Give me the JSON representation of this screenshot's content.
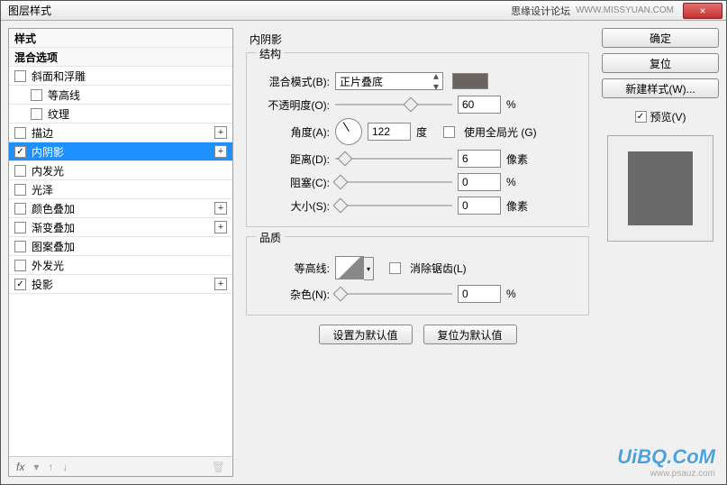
{
  "window": {
    "title": "图层样式",
    "brand": "思缘设计论坛",
    "brand_url": "WWW.MISSYUAN.COM",
    "close": "×"
  },
  "sidebar": {
    "header_styles": "样式",
    "header_blend": "混合选项",
    "items": [
      {
        "label": "斜面和浮雕",
        "checked": false,
        "indent": 0,
        "plus": false
      },
      {
        "label": "等高线",
        "checked": false,
        "indent": 1,
        "plus": false
      },
      {
        "label": "纹理",
        "checked": false,
        "indent": 1,
        "plus": false
      },
      {
        "label": "描边",
        "checked": false,
        "indent": 0,
        "plus": true
      },
      {
        "label": "内阴影",
        "checked": true,
        "indent": 0,
        "plus": true,
        "selected": true
      },
      {
        "label": "内发光",
        "checked": false,
        "indent": 0,
        "plus": false
      },
      {
        "label": "光泽",
        "checked": false,
        "indent": 0,
        "plus": false
      },
      {
        "label": "颜色叠加",
        "checked": false,
        "indent": 0,
        "plus": true
      },
      {
        "label": "渐变叠加",
        "checked": false,
        "indent": 0,
        "plus": true
      },
      {
        "label": "图案叠加",
        "checked": false,
        "indent": 0,
        "plus": false
      },
      {
        "label": "外发光",
        "checked": false,
        "indent": 0,
        "plus": false
      },
      {
        "label": "投影",
        "checked": true,
        "indent": 0,
        "plus": true
      }
    ],
    "footer_fx": "fx"
  },
  "panel": {
    "title": "内阴影",
    "structure": {
      "legend": "结构",
      "blend_label": "混合模式(B):",
      "blend_value": "正片叠底",
      "opacity_label": "不透明度(O):",
      "opacity_value": "60",
      "opacity_unit": "%",
      "angle_label": "角度(A):",
      "angle_value": "122",
      "angle_unit": "度",
      "global_light": "使用全局光 (G)",
      "distance_label": "距离(D):",
      "distance_value": "6",
      "distance_unit": "像素",
      "choke_label": "阻塞(C):",
      "choke_value": "0",
      "choke_unit": "%",
      "size_label": "大小(S):",
      "size_value": "0",
      "size_unit": "像素"
    },
    "quality": {
      "legend": "品质",
      "contour_label": "等高线:",
      "antialias": "消除锯齿(L)",
      "noise_label": "杂色(N):",
      "noise_value": "0",
      "noise_unit": "%"
    },
    "buttons": {
      "make_default": "设置为默认值",
      "reset_default": "复位为默认值"
    }
  },
  "right": {
    "ok": "确定",
    "reset": "复位",
    "new_style": "新建样式(W)...",
    "preview": "预览(V)"
  },
  "watermark": {
    "logo": "UiBQ.CoM",
    "sub": "www.psauz.com"
  }
}
